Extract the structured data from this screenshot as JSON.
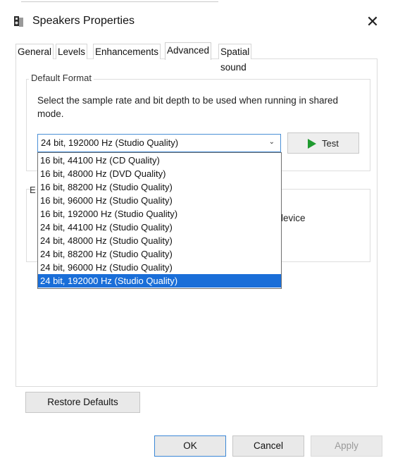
{
  "window": {
    "title": "Speakers Properties",
    "close_glyph": "✕"
  },
  "tabs": [
    "General",
    "Levels",
    "Enhancements",
    "Advanced",
    "Spatial sound"
  ],
  "active_tab": "Advanced",
  "default_format": {
    "group_title": "Default Format",
    "description": "Select the sample rate and bit depth to be used when running in shared mode.",
    "selected": "24 bit, 192000 Hz (Studio Quality)",
    "test_label": "Test",
    "options": [
      "16 bit, 44100 Hz (CD Quality)",
      "16 bit, 48000 Hz (DVD Quality)",
      "16 bit, 88200 Hz (Studio Quality)",
      "16 bit, 96000 Hz (Studio Quality)",
      "16 bit, 192000 Hz (Studio Quality)",
      "24 bit, 44100 Hz (Studio Quality)",
      "24 bit, 48000 Hz (Studio Quality)",
      "24 bit, 88200 Hz (Studio Quality)",
      "24 bit, 96000 Hz (Studio Quality)",
      "24 bit, 192000 Hz (Studio Quality)"
    ]
  },
  "exclusive_partial": {
    "group_title_fragment": "E",
    "device_fragment": "levice"
  },
  "buttons": {
    "restore_defaults": "Restore Defaults",
    "ok": "OK",
    "cancel": "Cancel",
    "apply": "Apply"
  },
  "colors": {
    "accent": "#1a6ed8",
    "play": "#1f9a2f",
    "focus_border": "#4a8fd6"
  },
  "icons": {
    "app": "speaker-icon",
    "test": "play-icon",
    "dropdown": "chevron-down-icon"
  }
}
